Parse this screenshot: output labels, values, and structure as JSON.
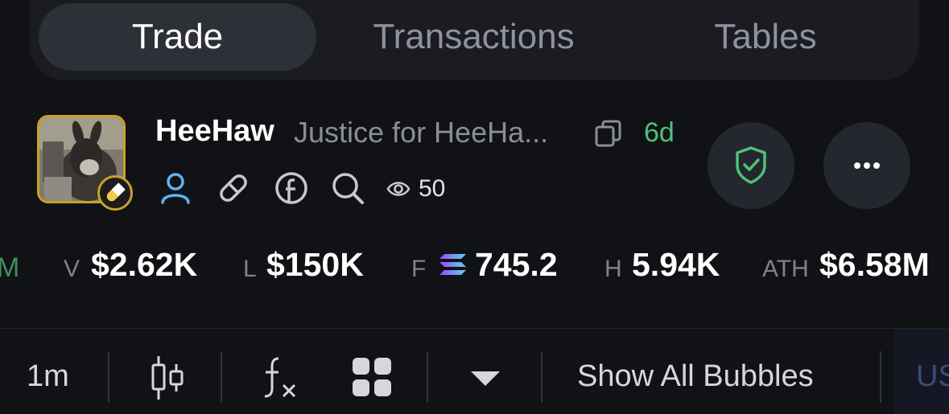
{
  "tabs": [
    {
      "label": "Trade",
      "active": true
    },
    {
      "label": "Transactions",
      "active": false
    },
    {
      "label": "Tables",
      "active": false
    }
  ],
  "token": {
    "name": "HeeHaw",
    "subtitle": "Justice for HeeHa...",
    "age": "6d",
    "views": "50"
  },
  "stats": [
    {
      "label": "M",
      "value": ""
    },
    {
      "label": "V",
      "value": "$2.62K"
    },
    {
      "label": "L",
      "value": "$150K"
    },
    {
      "label": "F",
      "value": "745.2"
    },
    {
      "label": "H",
      "value": "5.94K"
    },
    {
      "label": "ATH",
      "value": "$6.58M"
    }
  ],
  "toolbar": {
    "interval": "1m",
    "show_bubbles": "Show All Bubbles",
    "cut_off_text": "US"
  },
  "colors": {
    "background": "#111216",
    "accent_green": "#4dc27a",
    "avatar_border": "#c9a227",
    "user_icon_blue": "#5ab4f5"
  },
  "icons": [
    "copy-icon",
    "user-icon",
    "link-icon",
    "facebook-icon",
    "search-icon",
    "eye-icon",
    "shield-check-icon",
    "more-icon",
    "solana-icon",
    "candlestick-icon",
    "function-icon",
    "grid-icon",
    "chevron-down-icon",
    "pill-icon"
  ]
}
